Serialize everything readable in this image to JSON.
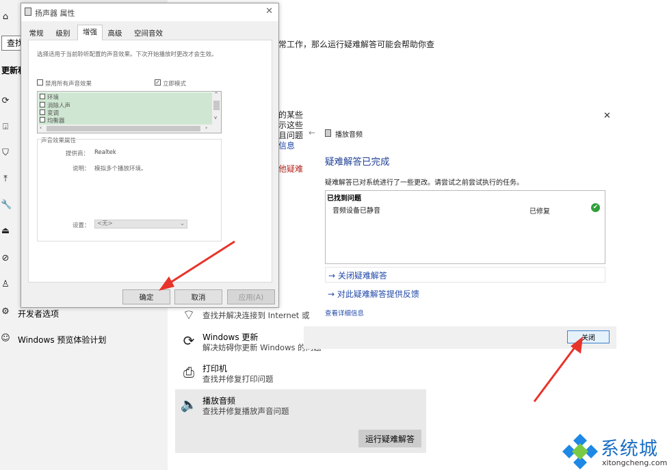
{
  "settings": {
    "search_text": "查找",
    "section_label": "更新和",
    "partial_title": "常工作，那么运行疑难解答可能会帮助你查",
    "partial_lines": [
      "的某些",
      "示这些",
      "且问题",
      "信息",
      "他疑难"
    ],
    "developer_options": "开发者选项",
    "insider_program": "Windows 预览体验计划",
    "items": [
      {
        "title": "",
        "desc": "查找并解决连接到 Internet 或"
      },
      {
        "title": "Windows 更新",
        "desc": "解决妨碍你更新 Windows 的问题"
      },
      {
        "title": "打印机",
        "desc": "查找并修复打印问题"
      },
      {
        "title": "播放音频",
        "desc": "查找并修复播放声音问题"
      }
    ],
    "run_button": "运行疑难解答"
  },
  "properties_dialog": {
    "title": "扬声器 属性",
    "tabs": [
      "常规",
      "级别",
      "增强",
      "高级",
      "空间音效"
    ],
    "active_tab": "增强",
    "instruction": "选择适用于当前聆听配置的声音效果。下次开始播放时更改才会生效。",
    "disable_all_label": "禁用所有声音效果",
    "immediate_mode_label": "立即模式",
    "effects": [
      "环境",
      "消除人声",
      "变调",
      "均衡器"
    ],
    "fx_props_header": "声音效果属性",
    "provider_label": "提供商：",
    "provider_value": "Realtek",
    "description_label": "说明：",
    "description_value": "模拟多个播放环境。",
    "setting_label": "设置：",
    "setting_value": "<无>",
    "ok_button": "确定",
    "cancel_button": "取消",
    "apply_button": "应用(A)"
  },
  "troubleshooter": {
    "nav_title": "播放音频",
    "heading": "疑难解答已完成",
    "description": "疑难解答已对系统进行了一些更改。请尝试之前尝试执行的任务。",
    "found_header": "已找到问题",
    "issue": "音频设备已静音",
    "status": "已修复",
    "link_close": "关闭疑难解答",
    "link_feedback": "对此疑难解答提供反馈",
    "details_link": "查看详细信息",
    "close_button": "关闭"
  },
  "watermark": {
    "brand": "系统城",
    "url": "xitongcheng.com"
  },
  "colors": {
    "accent_blue": "#1f47a8",
    "arrow_red": "#e8332a",
    "list_highlight": "#cfe7d2"
  }
}
